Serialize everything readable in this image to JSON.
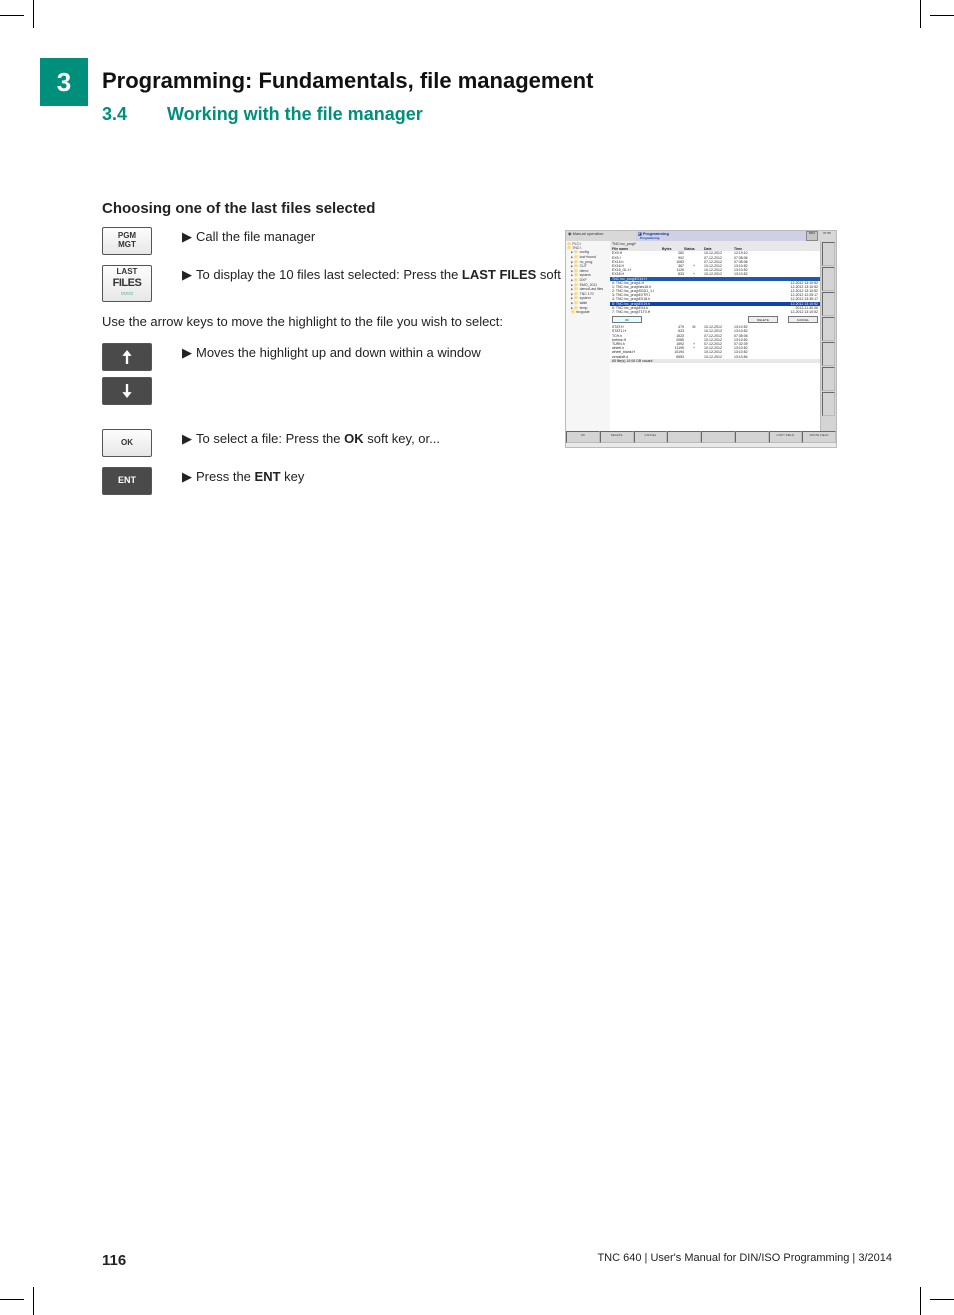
{
  "chapter": {
    "number": "3",
    "title": "Programming: Fundamentals, file management"
  },
  "section": {
    "number": "3.4",
    "title": "Working with the file manager"
  },
  "heading": "Choosing one of the last files selected",
  "keys": {
    "pgm_mgt_l1": "PGM",
    "pgm_mgt_l2": "MGT",
    "last_files_l1": "LAST",
    "last_files_l2": "FILES",
    "ok": "OK",
    "ent": "ENT"
  },
  "body": {
    "p1": "Call the file manager",
    "p2a": "To display the 10 files last selected: Press the ",
    "p2b": "LAST FILES",
    "p2c": " soft key.",
    "p3": "Use the arrow keys to move the highlight to the file you wish to select:",
    "p4": "Moves the highlight up and down within a window",
    "p5a": "To select a file: Press the ",
    "p5b": "OK",
    "p5c": " soft key, or...",
    "p6a": "Press the ",
    "p6b": "ENT",
    "p6c": " key"
  },
  "screenshot": {
    "mode_left": "Manual operation",
    "mode_right": "Programming",
    "mode_sub": "Programming",
    "dnc": "DNC",
    "time": "07:35",
    "tree": [
      "PLC:\\",
      "TNC:\\",
      "config",
      "lost+found",
      "nc_prog",
      "CUT",
      "demo",
      "system",
      "DXF",
      "EMO_2011",
      "demo/Last files",
      "TNC 170",
      "system",
      "table",
      "temp",
      "tncguide"
    ],
    "path": "TNC:\\nc_prog\\*",
    "columns": [
      "File name",
      "Bytes",
      "Status",
      "Date",
      "Time"
    ],
    "rows_top": [
      {
        "n": "EX9.H",
        "b": "282",
        "s": "",
        "d": "10-12-2012",
        "t": "12:19:10"
      },
      {
        "n": "EX9.I",
        "b": "902",
        "s": "",
        "d": "07-12-2012",
        "t": "07:35:06"
      },
      {
        "n": "EX14.h",
        "b": "1083",
        "s": "",
        "d": "07-12-2012",
        "t": "07:35:06"
      },
      {
        "n": "EX16.H",
        "b": "367",
        "s": "+",
        "d": "10-12-2012",
        "t": "13:10:52"
      },
      {
        "n": "EX16_GL.H",
        "b": "1126",
        "s": "",
        "d": "10-12-2012",
        "t": "13:10:52"
      },
      {
        "n": "EX18.H",
        "b": "833",
        "s": "+",
        "d": "10-12-2012",
        "t": "13:10:52"
      }
    ],
    "dialog_title": "TNC:\\nc_prog\\EX19.H",
    "dialog_items": [
      {
        "i": "0:",
        "t": "TNC:\\nc_prog\\1.H"
      },
      {
        "i": "1:",
        "t": "TNC:\\nc_prog\\hes16.h"
      },
      {
        "i": "2:",
        "t": "TNC:\\nc_prog\\SGD1_1.I"
      },
      {
        "i": "3:",
        "t": "TNC:\\nc_prog\\EXTR.I"
      },
      {
        "i": "4:",
        "t": "TNC:\\nc_prog\\EX18.h"
      },
      {
        "i": "5:",
        "t": "TNC:\\nc_prog\\EX19.h"
      },
      {
        "i": "6:",
        "t": "TNC:\\nc_prog\\EX4.h"
      },
      {
        "i": "7:",
        "t": "TNC:\\nc_prog\\T1T0.H"
      }
    ],
    "dialog_selected_index": 5,
    "dialog_dates": [
      "12-2012 13:10:52",
      "12-2012 13:10:52",
      "12-2012 13:10:52",
      "12-2012 12:25:17",
      "12-2012 13:35:17",
      "12-2012 13:10:52",
      "2012-11-30 06",
      "12-2012 13:10:52",
      "12-2012 13:10:52",
      "12-2012 13:10:52",
      "12-2012 13:10:52",
      "12-2012 13:10:52"
    ],
    "btn_ok": "OK",
    "btn_delete": "DELETE",
    "btn_cancel": "CANCEL",
    "rows_bottom": [
      {
        "n": "STAT.H",
        "b": "479",
        "s": "M",
        "d": "10-12-2012",
        "t": "13:10:52"
      },
      {
        "n": "STAT1.H",
        "b": "623",
        "s": "",
        "d": "10-12-2012",
        "t": "13:10:52"
      },
      {
        "n": "TCH.h",
        "b": "1523",
        "s": "",
        "d": "07-12-2012",
        "t": "07:35:06"
      },
      {
        "n": "turbine.H",
        "b": "2065",
        "s": "",
        "d": "10-12-2012",
        "t": "13:10:52"
      },
      {
        "n": "TURN.h",
        "b": "1692",
        "s": "+",
        "d": "07-12-2012",
        "t": "07:32:39"
      },
      {
        "n": "wheel.h",
        "b": "11195",
        "s": "+",
        "d": "10-12-2012",
        "t": "13:10:52"
      },
      {
        "n": "wheel_blank.H",
        "b": "10194",
        "s": "",
        "d": "10-12-2012",
        "t": "13:10:52"
      },
      {
        "n": "zeroshift.d",
        "b": "6553",
        "s": "",
        "d": "10-12-2012",
        "t": "13:10:54"
      }
    ],
    "status": "65  file(s)  19.06 GB vacant",
    "softkeys": [
      "OK",
      "DELETE",
      "CANCEL",
      "",
      "",
      "",
      "COPY\nFIELD",
      "PASTE\nFIELD"
    ]
  },
  "footer": {
    "page": "116",
    "text": "TNC 640 | User's Manual for DIN/ISO Programming | 3/2014"
  }
}
